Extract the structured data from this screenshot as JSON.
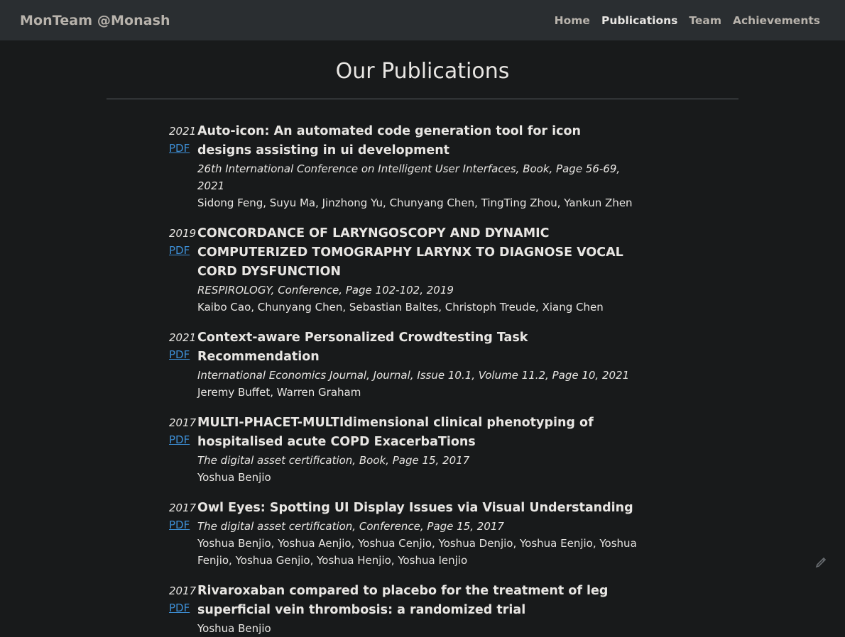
{
  "navbar": {
    "brand": "MonTeam @Monash",
    "links": [
      "Home",
      "Publications",
      "Team",
      "Achievements"
    ]
  },
  "page": {
    "title": "Our Publications"
  },
  "publications": [
    {
      "year": "2021",
      "pdf": "PDF",
      "title": "Auto-icon: An automated code generation tool for icon designs assisting in ui development",
      "venue": "26th International Conference on Intelligent User Interfaces, Book, Page 56-69, 2021",
      "authors": "Sidong Feng, Suyu Ma, Jinzhong Yu, Chunyang Chen, TingTing Zhou, Yankun Zhen"
    },
    {
      "year": "2019",
      "pdf": "PDF",
      "title": "CONCORDANCE OF LARYNGOSCOPY AND DYNAMIC COMPUTERIZED TOMOGRAPHY LARYNX TO DIAGNOSE VOCAL CORD DYSFUNCTION",
      "venue": "RESPIROLOGY, Conference, Page 102-102, 2019",
      "authors": "Kaibo Cao, Chunyang Chen, Sebastian Baltes, Christoph Treude, Xiang Chen"
    },
    {
      "year": "2021",
      "pdf": "PDF",
      "title": "Context-aware Personalized Crowdtesting Task Recommendation",
      "venue": "International Economics Journal, Journal, Issue 10.1, Volume 11.2, Page 10, 2021",
      "authors": "Jeremy Buffet, Warren Graham"
    },
    {
      "year": "2017",
      "pdf": "PDF",
      "title": "MULTI-PHACET-MULTIdimensional clinical phenotyping of hospitalised acute COPD ExacerbaTions",
      "venue": "The digital asset certification, Book, Page 15, 2017",
      "authors": "Yoshua Benjio"
    },
    {
      "year": "2017",
      "pdf": "PDF",
      "title": "Owl Eyes: Spotting UI Display Issues via Visual Understanding",
      "venue": "The digital asset certification, Conference, Page 15, 2017",
      "authors": "Yoshua Benjio, Yoshua Aenjio, Yoshua Cenjio, Yoshua Denjio, Yoshua Eenjio, Yoshua Fenjio, Yoshua Genjio, Yoshua Henjio, Yoshua Ienjio"
    },
    {
      "year": "2017",
      "pdf": "PDF",
      "title": "Rivaroxaban compared to placebo for the treatment of leg superficial vein thrombosis: a randomized trial",
      "venue": "",
      "authors": "Yoshua Benjio"
    }
  ],
  "colors": {
    "background": "#181a1b",
    "navbar": "#2a2e31",
    "link": "#3d8fd6"
  },
  "icons": {
    "badge": "pencil-icon"
  }
}
